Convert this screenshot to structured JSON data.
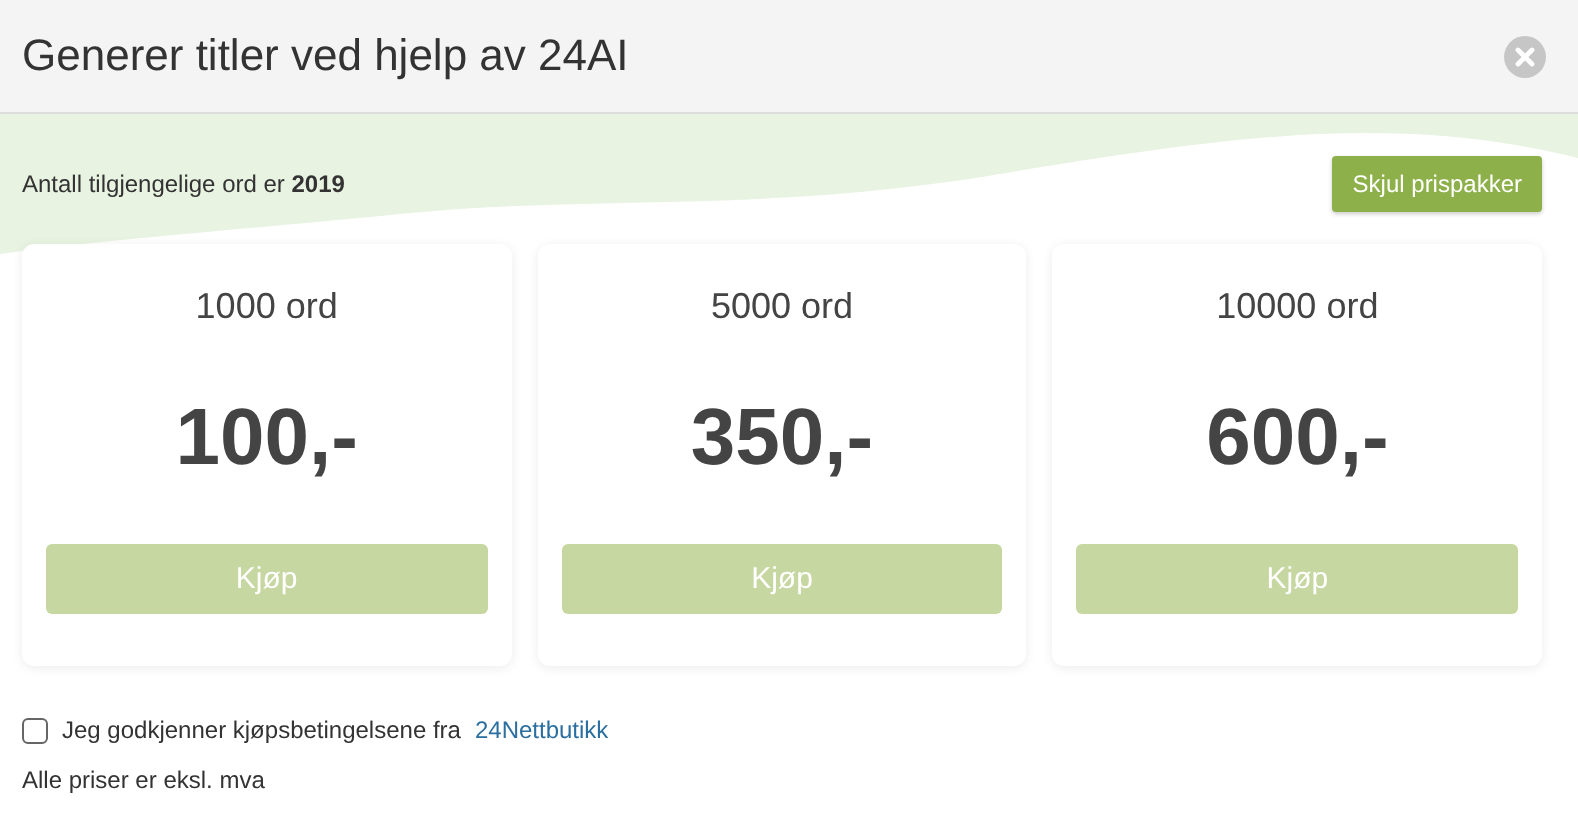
{
  "window": {
    "title": "Generer titler ved hjelp av 24AI"
  },
  "available": {
    "text": "Antall tilgjengelige ord er **2019**"
  },
  "toggle_button": {
    "label": "Skjul prispakker"
  },
  "packages": [
    {
      "title": "1000 ord",
      "price": "100,-",
      "button": "Kjøp",
      "disabled": true
    },
    {
      "title": "5000 ord",
      "price": "350,-",
      "button": "Kjøp",
      "disabled": true
    },
    {
      "title": "10000 ord",
      "price": "600,-",
      "button": "Kjøp",
      "disabled": true
    }
  ],
  "terms": {
    "checked": false,
    "label": "Jeg godkjenner kjøpsbetingelsene fra",
    "link": "24Nettbutikk"
  },
  "note": "Alle priser er eksl. mva"
}
